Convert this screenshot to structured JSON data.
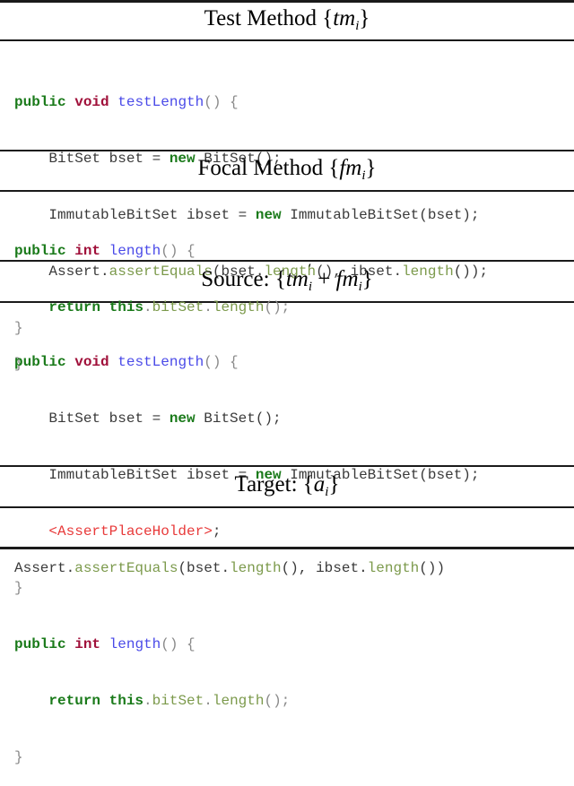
{
  "sections": {
    "test_method": {
      "title_prefix": "Test Method ",
      "title_math": "tm",
      "title_sub": "i",
      "lines": {
        "l1": {
          "kw1": "public",
          "kw2": "void",
          "name": "testLength",
          "rest": "() {"
        },
        "l2": {
          "pre": "    BitSet bset = ",
          "kw": "new",
          "post": " BitSet();"
        },
        "l3": {
          "pre": "    ImmutableBitSet ibset = ",
          "kw": "new",
          "post": " ImmutableBitSet(bset);"
        },
        "l4": {
          "obj": "    Assert.",
          "m1": "assertEquals",
          "a1": "(bset.",
          "m2": "length",
          "a2": "(), ibset.",
          "m3": "length",
          "a3": "());"
        },
        "l5": {
          "close": "}"
        }
      }
    },
    "focal_method": {
      "title_prefix": "Focal Method ",
      "title_math": "fm",
      "title_sub": "i",
      "lines": {
        "l1": {
          "kw1": "public",
          "kw2": "int",
          "name": "length",
          "rest": "() {"
        },
        "l2": {
          "indent": "    ",
          "kw1": "return",
          "kw2": "this",
          "dot": ".",
          "m1": "bitSet",
          "dot2": ".",
          "m2": "length",
          "end": "();"
        },
        "l3": {
          "close": "}"
        }
      }
    },
    "source": {
      "title_prefix": "Source: ",
      "title_math1": "tm",
      "title_prime": "′",
      "title_sub1": "i",
      "title_plus": " + ",
      "title_math2": "fm",
      "title_sub2": "i",
      "lines": {
        "l1": {
          "kw1": "public",
          "kw2": "void",
          "name": "testLength",
          "rest": "() {"
        },
        "l2": {
          "pre": "    BitSet bset = ",
          "kw": "new",
          "post": " BitSet();"
        },
        "l3": {
          "pre": "    ImmutableBitSet ibset = ",
          "kw": "new",
          "post": " ImmutableBitSet(bset);"
        },
        "l4": {
          "indent": "    ",
          "placeholder": "<AssertPlaceHolder>",
          "end": ";"
        },
        "l5": {
          "close": "}"
        },
        "l6": {
          "kw1": "public",
          "kw2": "int",
          "name": "length",
          "rest": "() {"
        },
        "l7": {
          "indent": "    ",
          "kw1": "return",
          "kw2": "this",
          "dot": ".",
          "m1": "bitSet",
          "dot2": ".",
          "m2": "length",
          "end": "();"
        },
        "l8": {
          "close": "}"
        }
      }
    },
    "target": {
      "title_prefix": "Target: ",
      "title_math": "a",
      "title_sub": "i",
      "lines": {
        "l1": {
          "obj": "Assert.",
          "m1": "assertEquals",
          "a1": "(bset.",
          "m2": "length",
          "a2": "(), ibset.",
          "m3": "length",
          "a3": "())"
        }
      }
    }
  }
}
